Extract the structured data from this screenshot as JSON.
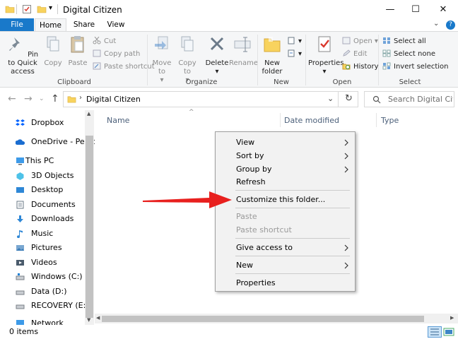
{
  "window": {
    "title": "Digital Citizen",
    "minimize": "—",
    "maximize": "☐",
    "close": "✕"
  },
  "tabs": {
    "file": "File",
    "home": "Home",
    "share": "Share",
    "view": "View"
  },
  "ribbon": {
    "pin_to_quick_access": "Pin to Quick access",
    "copy": "Copy",
    "paste": "Paste",
    "cut": "Cut",
    "copy_path": "Copy path",
    "paste_shortcut": "Paste shortcut",
    "move_to": "Move to",
    "copy_to": "Copy to",
    "delete": "Delete",
    "rename": "Rename",
    "new_folder": "New folder",
    "properties": "Properties",
    "open": "Open",
    "edit": "Edit",
    "history": "History",
    "select_all": "Select all",
    "select_none": "Select none",
    "invert_selection": "Invert selection",
    "groups": {
      "clipboard": "Clipboard",
      "organize": "Organize",
      "new": "New",
      "open": "Open",
      "select": "Select"
    }
  },
  "address": {
    "path": "Digital Citizen",
    "search_placeholder": "Search Digital Citiz..."
  },
  "nav": {
    "items": [
      {
        "label": "Dropbox",
        "icon": "dropbox-icon"
      },
      {
        "label": "OneDrive - Person",
        "icon": "onedrive-icon"
      },
      {
        "label": "This PC",
        "icon": "this-pc-icon"
      },
      {
        "label": "3D Objects",
        "icon": "3d-objects-icon"
      },
      {
        "label": "Desktop",
        "icon": "desktop-icon"
      },
      {
        "label": "Documents",
        "icon": "documents-icon"
      },
      {
        "label": "Downloads",
        "icon": "downloads-icon"
      },
      {
        "label": "Music",
        "icon": "music-icon"
      },
      {
        "label": "Pictures",
        "icon": "pictures-icon"
      },
      {
        "label": "Videos",
        "icon": "videos-icon"
      },
      {
        "label": "Windows (C:)",
        "icon": "drive-icon"
      },
      {
        "label": "Data (D:)",
        "icon": "drive-icon"
      },
      {
        "label": "RECOVERY (E:)",
        "icon": "drive-icon"
      },
      {
        "label": "Network",
        "icon": "network-icon"
      }
    ]
  },
  "columns": {
    "name": "Name",
    "date_modified": "Date modified",
    "type": "Type"
  },
  "context_menu": {
    "view": "View",
    "sort_by": "Sort by",
    "group_by": "Group by",
    "refresh": "Refresh",
    "customize": "Customize this folder...",
    "paste": "Paste",
    "paste_shortcut": "Paste shortcut",
    "give_access": "Give access to",
    "new": "New",
    "properties": "Properties"
  },
  "status": {
    "items": "0 items"
  },
  "colors": {
    "accent": "#1979ca",
    "arrow": "#e8201e",
    "folder": "#f8d35e"
  }
}
